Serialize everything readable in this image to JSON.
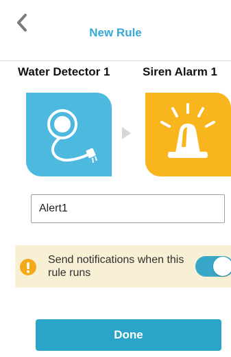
{
  "header": {
    "title": "New Rule",
    "back_icon": "chevron-left-icon"
  },
  "devices": {
    "source": {
      "name": "Water Detector 1",
      "icon": "water-detector-icon",
      "color": "#4eb9df"
    },
    "target": {
      "name": "Siren Alarm 1",
      "icon": "siren-alarm-icon",
      "color": "#f8b51e"
    },
    "connector_icon": "play-arrow-icon"
  },
  "rule_name": {
    "value": "Alert1"
  },
  "notification": {
    "text": "Send notifications when this rule runs",
    "icon": "warning-icon",
    "enabled": true,
    "accent_color": "#38a7c8",
    "background_color": "#f8f0d5"
  },
  "actions": {
    "done_label": "Done",
    "done_color": "#2aa4c8"
  },
  "colors": {
    "title": "#35a9d6",
    "text": "#111111",
    "divider": "#dcdcdc"
  }
}
